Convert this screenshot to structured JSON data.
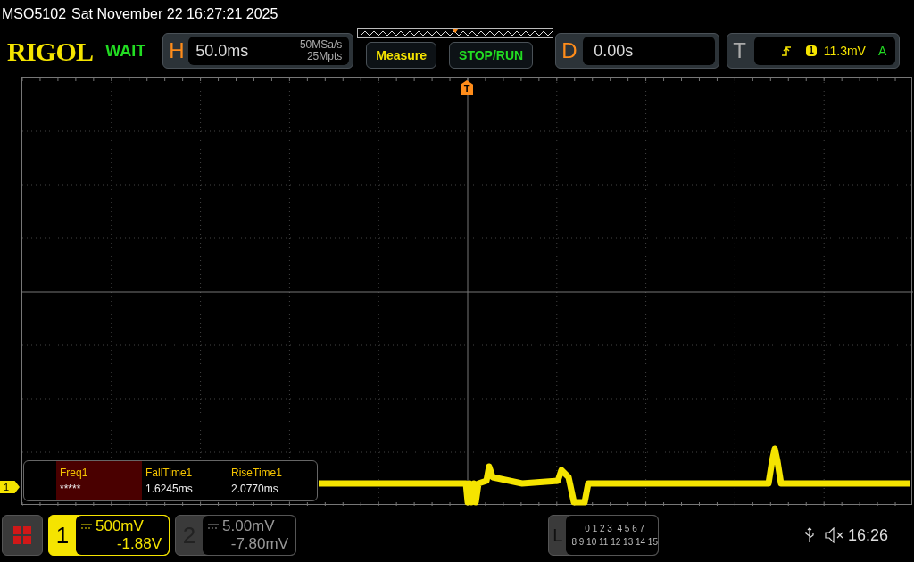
{
  "status_bar": {
    "model": "MSO5102",
    "datetime": "Sat November 22 16:27:21 2025"
  },
  "header": {
    "logo": "RIGOL",
    "run_state": "WAIT",
    "horizontal": {
      "label": "H",
      "timebase": "50.0ms",
      "sample_rate": "50MSa/s",
      "memory_depth": "25Mpts"
    },
    "buttons": [
      {
        "label": "Measure",
        "kind": "measure"
      },
      {
        "label": "STOP/RUN",
        "kind": "run"
      }
    ],
    "delay": {
      "label": "D",
      "value": "0.00s"
    },
    "trigger": {
      "label": "T",
      "source": "1",
      "level": "11.3mV",
      "mode": "A"
    }
  },
  "screen": {
    "trigger_marker": "T",
    "channel_marker": "1",
    "measurements": [
      {
        "name": "Freq1",
        "value": "*****",
        "selected": true
      },
      {
        "name": "FallTime1",
        "value": "1.6245ms",
        "selected": false
      },
      {
        "name": "RiseTime1",
        "value": "2.0770ms",
        "selected": false
      }
    ]
  },
  "footer": {
    "channels": [
      {
        "number": "1",
        "scale": "500mV",
        "offset": "-1.88V",
        "selected": true
      },
      {
        "number": "2",
        "scale": "5.00mV",
        "offset": "-7.80mV",
        "selected": false
      }
    ],
    "logic": {
      "label": "L",
      "rows": [
        "0 1 2 3  4 5 6 7",
        "8 9 10 11 12 13 14 15"
      ]
    },
    "clock": "16:26"
  }
}
